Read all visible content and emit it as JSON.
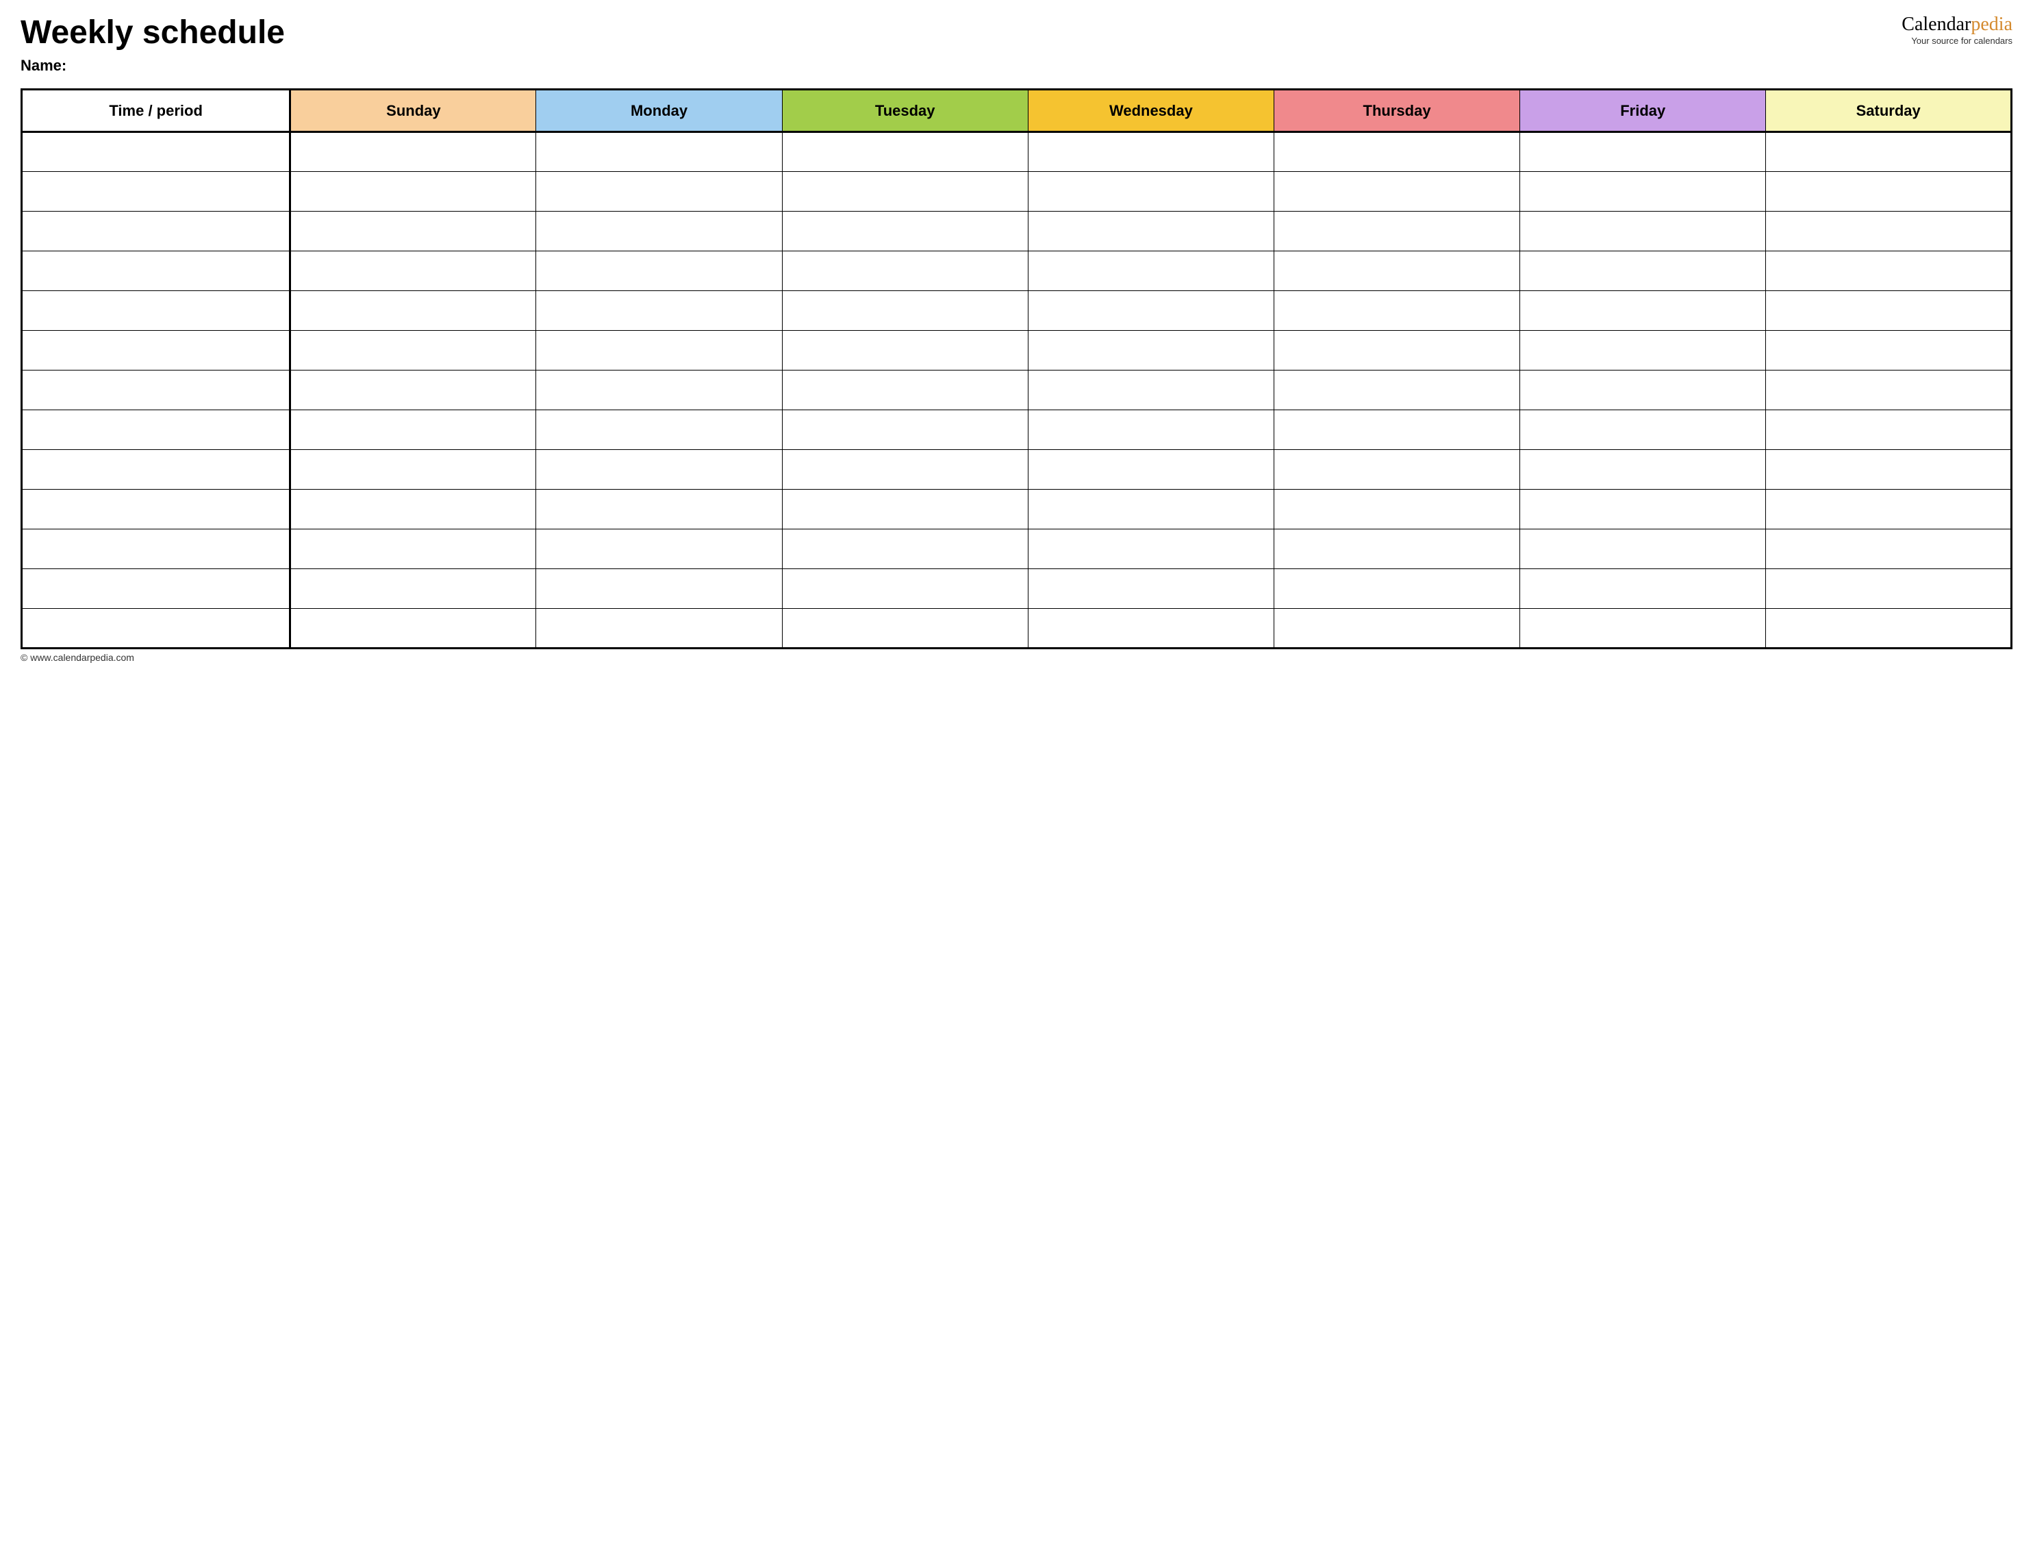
{
  "header": {
    "title": "Weekly schedule",
    "name_label": "Name:",
    "logo_part1": "Calendar",
    "logo_part2": "pedia",
    "logo_tagline": "Your source for calendars"
  },
  "table": {
    "time_header": "Time / period",
    "days": [
      {
        "label": "Sunday",
        "color": "#f9cf9c"
      },
      {
        "label": "Monday",
        "color": "#a0cef0"
      },
      {
        "label": "Tuesday",
        "color": "#a2cd4a"
      },
      {
        "label": "Wednesday",
        "color": "#f5c330"
      },
      {
        "label": "Thursday",
        "color": "#f0898c"
      },
      {
        "label": "Friday",
        "color": "#c9a0e8"
      },
      {
        "label": "Saturday",
        "color": "#f8f6b8"
      }
    ],
    "row_count": 13
  },
  "footer": {
    "copyright": "© www.calendarpedia.com"
  }
}
